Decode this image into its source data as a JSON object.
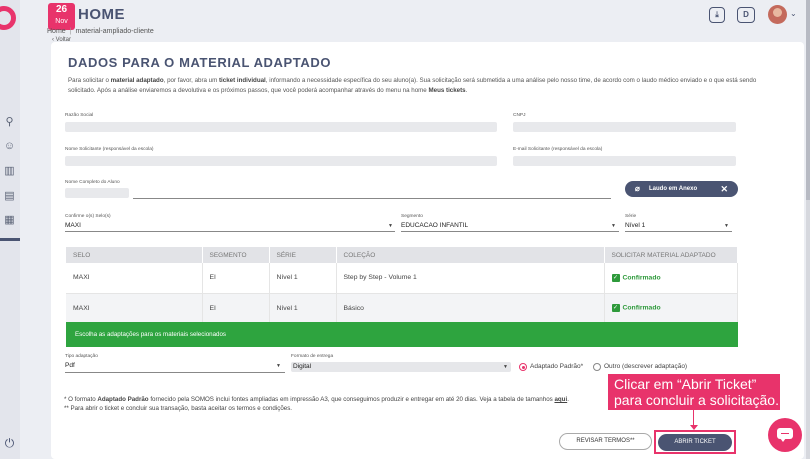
{
  "header": {
    "date_day": "26",
    "date_month": "Nov",
    "title": "HOME",
    "breadcrumb": [
      "Home",
      "material-ampliado-cliente"
    ],
    "back_label": "Voltar",
    "cart_icon": "download-box-icon",
    "d_button": "D",
    "avatar_chevron": "⌄"
  },
  "card": {
    "title": "DADOS PARA O MATERIAL ADAPTADO",
    "intro_parts": {
      "p1": "Para solicitar o ",
      "b1": "material adaptado",
      "p2": ", por favor, abra um ",
      "b2": "ticket individual",
      "p3": ", informando a necessidade específica do seu aluno(a). Sua solicitação será submetida a uma análise pelo nosso time, de acordo com o laudo médico enviado e o que está sendo solicitado. Após a análise enviaremos a devolutiva e os próximos passos, que você poderá acompanhar através do menu na home ",
      "b3": "Meus tickets",
      "p4": "."
    }
  },
  "form": {
    "razao_social_label": "Razão Social",
    "cnpj_label": "CNPJ",
    "solicitante_label": "Nome Solicitante (responsável da escola)",
    "email_label": "E-mail Solicitante (responsável da escola)",
    "aluno_label": "Nome Completo do Aluno",
    "anexo_button": "Laudo em Anexo",
    "selo_label": "Confirme o(s) Selo(s)",
    "selo_value": "MAXI",
    "segmento_label": "Segmento",
    "segmento_value": "EDUCACAO INFANTIL",
    "serie_label": "Série",
    "serie_value": "Nível 1"
  },
  "table": {
    "headers": [
      "SELO",
      "SEGMENTO",
      "SÉRIE",
      "COLEÇÃO",
      "SOLICITAR MATERIAL ADAPTADO"
    ],
    "rows": [
      {
        "selo": "MAXI",
        "segmento": "EI",
        "serie": "Nível 1",
        "colecao": "Step by Step - Volume 1",
        "status": "Confirmado"
      },
      {
        "selo": "MAXI",
        "segmento": "EI",
        "serie": "Nível 1",
        "colecao": "Básico",
        "status": "Confirmado"
      }
    ],
    "green_bar_text": "Escolha as adaptações para os materiais selecionados"
  },
  "adaptation": {
    "tipo_label": "Tipo adaptação",
    "tipo_value": "Pdf",
    "formato_label": "Formato de entrega",
    "formato_value": "Digital",
    "radio_padrao": "Adaptado Padrão*",
    "radio_outro": "Outro (descrever adaptação)"
  },
  "footnotes": {
    "line1_pre": "* O formato ",
    "line1_bold": "Adaptado Padrão",
    "line1_post": " fornecido pela SOMOS inclui fontes ampliadas em impressão A3, que conseguimos produzir e entregar em até 20 dias. Veja a tabela de tamanhos ",
    "line1_link": "aqui",
    "line1_end": ".",
    "line2": "** Para abrir o ticket e concluir sua transação, basta aceitar os termos e condições."
  },
  "buttons": {
    "revisar": "REVISAR TERMOS**",
    "abrir": "ABRIR TICKET"
  },
  "callout": {
    "line1": "Clicar em “Abrir Ticket”",
    "line2": "para concluir a solicitação."
  },
  "colors": {
    "brand_pink": "#e8336b",
    "navy": "#4a5472",
    "green": "#2ea43f"
  }
}
